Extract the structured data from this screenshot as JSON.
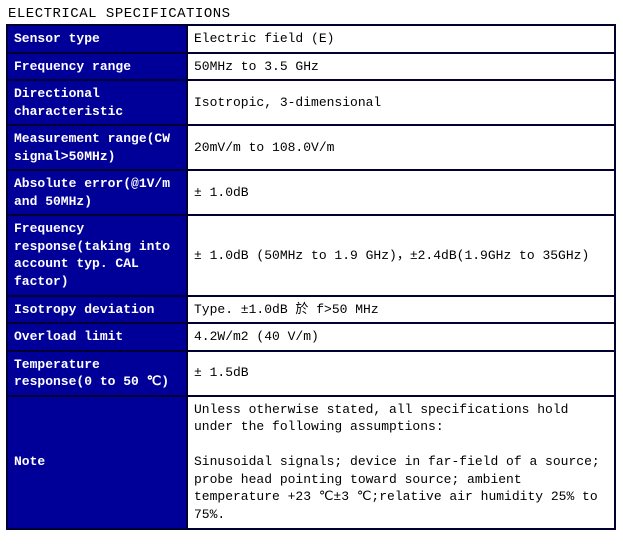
{
  "title": "ELECTRICAL SPECIFICATIONS",
  "rows": [
    {
      "label": "Sensor type",
      "value": "Electric field (E)"
    },
    {
      "label": "Frequency range",
      "value": "50MHz to 3.5 GHz"
    },
    {
      "label": "Directional characteristic",
      "value": "Isotropic, 3-dimensional"
    },
    {
      "label": "Measurement range(CW signal>50MHz)",
      "value": "20mV/m to 108.0V/m"
    },
    {
      "label": "Absolute error(@1V/m and 50MHz)",
      "value": "± 1.0dB"
    },
    {
      "label": "Frequency response(taking into account typ. CAL factor)",
      "value": "± 1.0dB (50MHz to 1.9 GHz)，±2.4dB(1.9GHz to 35GHz)"
    },
    {
      "label": "Isotropy deviation",
      "value": "Type. ±1.0dB 於 f>50 MHz"
    },
    {
      "label": "Overload limit",
      "value": "4.2W/m2 (40 V/m)"
    },
    {
      "label": "Temperature response(0 to 50 ℃)",
      "value": "± 1.5dB"
    },
    {
      "label": "Note",
      "value": "Unless otherwise stated, all specifications hold under the following assumptions:\n\nSinusoidal signals; device in far-field of a source; probe head pointing toward source; ambient temperature +23 ℃±3 ℃;relative air humidity 25% to 75%."
    }
  ]
}
